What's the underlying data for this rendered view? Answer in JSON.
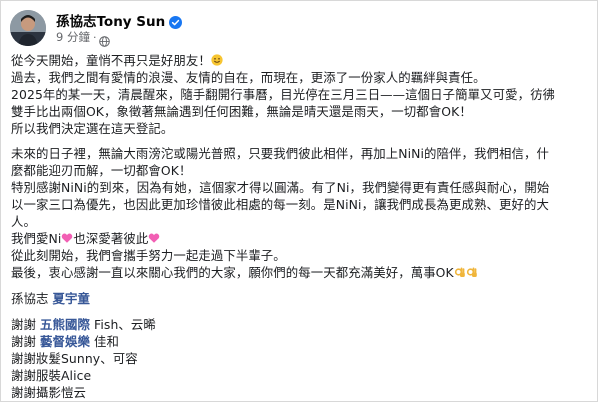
{
  "post": {
    "author": "孫協志Tony Sun",
    "timestamp": "9 分鐘",
    "verified_color": "#1877f2",
    "privacy_icon": "globe-icon"
  },
  "body": {
    "l1": "從今天開始，童悄不再只是好朋友！",
    "l2": "過去，我們之間有愛情的浪漫、友情的自在，而現在，更添了一份家人的羈絆與責任。",
    "l3": "2025年的某一天，清晨醒來，隨手翻開行事曆，目光停在三月三日——這個日子簡單又可愛，彷彿",
    "l4": "雙手比出兩個OK，象徵著無論遇到任何困難，無論是晴天還是雨天，一切都會OK！",
    "l5": "所以我們決定選在這天登記。",
    "l6": "未來的日子裡，無論大雨滂沱或陽光普照，只要我們彼此相伴，再加上NiNi的陪伴，我們相信，什",
    "l7": "麼都能迎刃而解，一切都會OK！",
    "l8": "特別感謝NiNi的到來，因為有她，這個家才得以圓滿。有了Ni，我們變得更有責任感與耐心，開始",
    "l9": "以一家三口為優先，也因此更加珍惜彼此相處的每一刻。是NiNi，讓我們成長為更成熟、更好的大",
    "l10": "人。",
    "l11a": "我們愛Ni",
    "l11b": "也深愛著彼此",
    "l12": "從此刻開始，我們會攜手努力一起走過下半輩子。",
    "l13": "最後，衷心感謝一直以來關心我們的大家，願你們的每一天都充滿美好，萬事OK",
    "sig_a": "孫協志 ",
    "sig_b": "夏宇童",
    "t1a": "謝謝 ",
    "t1b": "五熊國際",
    "t1c": " Fish、云晞",
    "t2a": "謝謝 ",
    "t2b": "藝督娛樂",
    "t2c": " 佳和",
    "t3": "謝謝妝髮Sunny、可容",
    "t4": "謝謝服裝Alice",
    "t5": "謝謝攝影愷云"
  },
  "colors": {
    "link": "#385898",
    "text": "#1c1e21",
    "meta": "#65676b"
  }
}
